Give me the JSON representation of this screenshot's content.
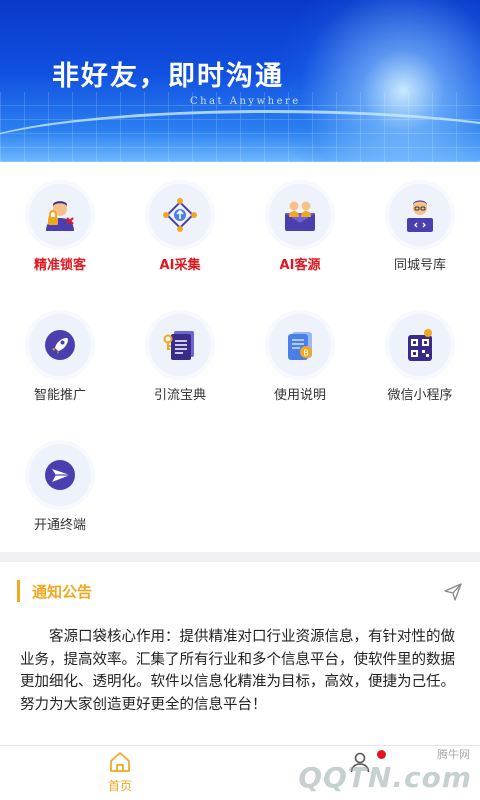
{
  "banner": {
    "title": "非好友，即时沟通",
    "subtitle": "Chat Anywhere"
  },
  "features": [
    {
      "label": "精准锁客",
      "icon": "user-lock-icon",
      "highlight": true
    },
    {
      "label": "AI采集",
      "icon": "collect-nodes-icon",
      "highlight": true
    },
    {
      "label": "AI客源",
      "icon": "customer-group-icon",
      "highlight": true
    },
    {
      "label": "同城号库",
      "icon": "programmer-icon",
      "highlight": false
    },
    {
      "label": "智能推广",
      "icon": "rocket-icon",
      "highlight": false
    },
    {
      "label": "引流宝典",
      "icon": "document-key-icon",
      "highlight": false
    },
    {
      "label": "使用说明",
      "icon": "manual-book-icon",
      "highlight": false
    },
    {
      "label": "微信小程序",
      "icon": "qrcode-icon",
      "highlight": false
    },
    {
      "label": "开通终端",
      "icon": "terminal-send-icon",
      "highlight": false
    }
  ],
  "notice": {
    "title": "通知公告",
    "body": "客源口袋核心作用：提供精准对口行业资源信息，有针对性的做业务，提高效率。汇集了所有行业和多个信息平台，使软件里的数据更加细化、透明化。软件以信息化精准为目标，高效，便捷为己任。努力为大家创造更好更全的信息平台！"
  },
  "tabbar": {
    "items": [
      {
        "label": "首页",
        "icon": "home-icon",
        "active": true
      },
      {
        "label": "",
        "icon": "user-icon",
        "active": false
      }
    ]
  },
  "watermark": {
    "small": "腾牛网",
    "big": "QQTN.com"
  },
  "colors": {
    "accent": "#f0a820",
    "highlight_red": "#e0171f",
    "banner_blue": "#1150e0",
    "icon_purple": "#4b3fb0"
  }
}
